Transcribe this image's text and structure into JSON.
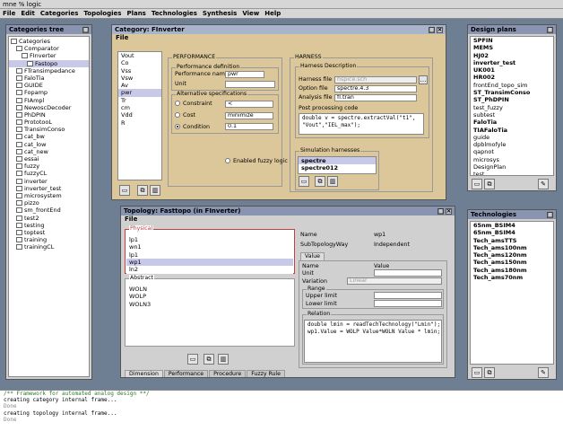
{
  "app": {
    "title": "mne % logic"
  },
  "menu": [
    "File",
    "Edit",
    "Categories",
    "Topologies",
    "Plans",
    "Technologies",
    "Synthesis",
    "View",
    "Help"
  ],
  "categories_tree": {
    "title": "Categories tree",
    "items": [
      {
        "label": "Categories",
        "level": 0
      },
      {
        "label": "Comparator",
        "level": 1
      },
      {
        "label": "FInverter",
        "level": 2
      },
      {
        "label": "Fastopo",
        "level": 3,
        "selected": true
      },
      {
        "label": "FTransimpedance",
        "level": 1
      },
      {
        "label": "FaloTia",
        "level": 1
      },
      {
        "label": "GUIDE",
        "level": 1
      },
      {
        "label": "Fopamp",
        "level": 1
      },
      {
        "label": "FIAmpl",
        "level": 1
      },
      {
        "label": "NewoscDecoder",
        "level": 1
      },
      {
        "label": "PhDPIN",
        "level": 1
      },
      {
        "label": "PrototooL",
        "level": 1
      },
      {
        "label": "TransimConso",
        "level": 1
      },
      {
        "label": "cat_bw",
        "level": 1
      },
      {
        "label": "cat_low",
        "level": 1
      },
      {
        "label": "cat_new",
        "level": 1
      },
      {
        "label": "essai",
        "level": 1
      },
      {
        "label": "fuzzy",
        "level": 1
      },
      {
        "label": "fuzzyCL",
        "level": 1
      },
      {
        "label": "inverter",
        "level": 1
      },
      {
        "label": "inverter_test",
        "level": 1
      },
      {
        "label": "microsystem",
        "level": 1
      },
      {
        "label": "pizzo",
        "level": 1
      },
      {
        "label": "sm_frontEnd",
        "level": 1
      },
      {
        "label": "test2",
        "level": 1
      },
      {
        "label": "testing",
        "level": 1
      },
      {
        "label": "toptest",
        "level": 1
      },
      {
        "label": "training",
        "level": 1
      },
      {
        "label": "trainingCL",
        "level": 1
      }
    ]
  },
  "category": {
    "title": "Category: FInverter",
    "menu": "File",
    "vars": [
      "Vout",
      "Co",
      "Vss",
      "Vsw",
      "Av",
      "pwr",
      "Tr",
      "cm",
      "Vdd",
      "R"
    ],
    "selected_var": "pwr",
    "performance_label": "PERFORMANCE",
    "perf_def_label": "Performance definition",
    "perf_name_label": "Performance name",
    "perf_name_value": "pwr",
    "unit_label": "Unit",
    "unit_value": "",
    "alt_spec_label": "Alternative specifications",
    "constraint_label": "Constraint",
    "constraint_value": "<",
    "cost_label": "Cost",
    "cost_value": "minimize",
    "condition_label": "Condition",
    "condition_value": "0.1",
    "fuzzy_label": "Enabled fuzzy logic",
    "harness_label": "HARNESS",
    "harness_desc_label": "Harness Description",
    "harness_file_label": "Harness file",
    "harness_file_value": "hspice.sch",
    "option_file_label": "Option file",
    "option_file_value": "spectre.4.3",
    "analysis_file_label": "Analysis file",
    "analysis_file_value": "fl.tran",
    "post_label": "Post processing code",
    "post_code": "double v = spectre.extractVal(\"t1\",\n\"Vout\",\"IEL_max\");",
    "sim_label": "Simulation harnesses",
    "simulators": [
      "spectre",
      "spectre012"
    ],
    "selected_sim": "spectre"
  },
  "topology": {
    "title": "Topology: Fasttopo (in FInverter)",
    "menu": "File",
    "physical_label": "Physical",
    "physical": [
      "lp1",
      "wn1",
      "lp1",
      "wp1",
      "ln2"
    ],
    "selected_physical": 3,
    "abstract_label": "Abstract",
    "abstract": [
      "WOLN",
      "WOLP",
      "WOLN3"
    ],
    "name_label": "Name",
    "name_value": "wp1",
    "subtopo_label": "SubTopologyWay",
    "subtopo_value": "Independent",
    "value_tab": "Value",
    "vname_label": "Name",
    "value_col": "Value",
    "unit_label": "Unit",
    "variation_label": "Variation",
    "variation_value": "Linear",
    "range_label": "Range",
    "upper_label": "Upper limit",
    "lower_label": "Lower limit",
    "relation_label": "Relation",
    "relation_code": "double lmin = readTechTechnology(\"Lmin\");\nwp1.Value = WOLP Value*WOLN Value * lmin;",
    "tabs": [
      "Dimension",
      "Performance",
      "Procedure",
      "Fuzzy Rule"
    ],
    "active_tab": "Dimension"
  },
  "design_plans": {
    "title": "Design plans",
    "items": [
      "SPFIN",
      "MEMS",
      "HJ02",
      "inverter_test",
      "UK001",
      "HR002",
      "frontEnd_topo_sim",
      "ST_TransimConso",
      "ST_PhDPIN",
      "test_fuzzy",
      "subtest",
      "FaloTia",
      "TIAFaloTia",
      "guide",
      "dpblmofyle",
      "qapnot",
      "microsys",
      "DesignPlan",
      "test"
    ],
    "bold_items": [
      "SPFIN",
      "MEMS",
      "HJ02",
      "inverter_test",
      "UK001",
      "HR002",
      "ST_TransimConso",
      "ST_PhDPIN",
      "FaloTia",
      "TIAFaloTia"
    ]
  },
  "technologies": {
    "title": "Technologies",
    "items": [
      "65nm_BSIM4",
      "65nm_BSIM4",
      "Tech_amsTTS",
      "Tech_ams100nm",
      "Tech_ams120nm",
      "Tech_ams150nm",
      "Tech_ams180nm",
      "Tech_ams70nm"
    ]
  },
  "console": [
    {
      "text": "/** Framework for automated analog design **/",
      "style": "c"
    },
    {
      "text": "creating category internal frame...",
      "style": ""
    },
    {
      "text": "Done",
      "style": "g"
    },
    {
      "text": "creating topology internal frame...",
      "style": ""
    },
    {
      "text": "Done",
      "style": "g"
    }
  ],
  "colors": {
    "desktop": "#6f7f93",
    "category_bg": "#dcc79a",
    "window_bg": "#d0d0d0",
    "physical_border": "#c04040"
  }
}
